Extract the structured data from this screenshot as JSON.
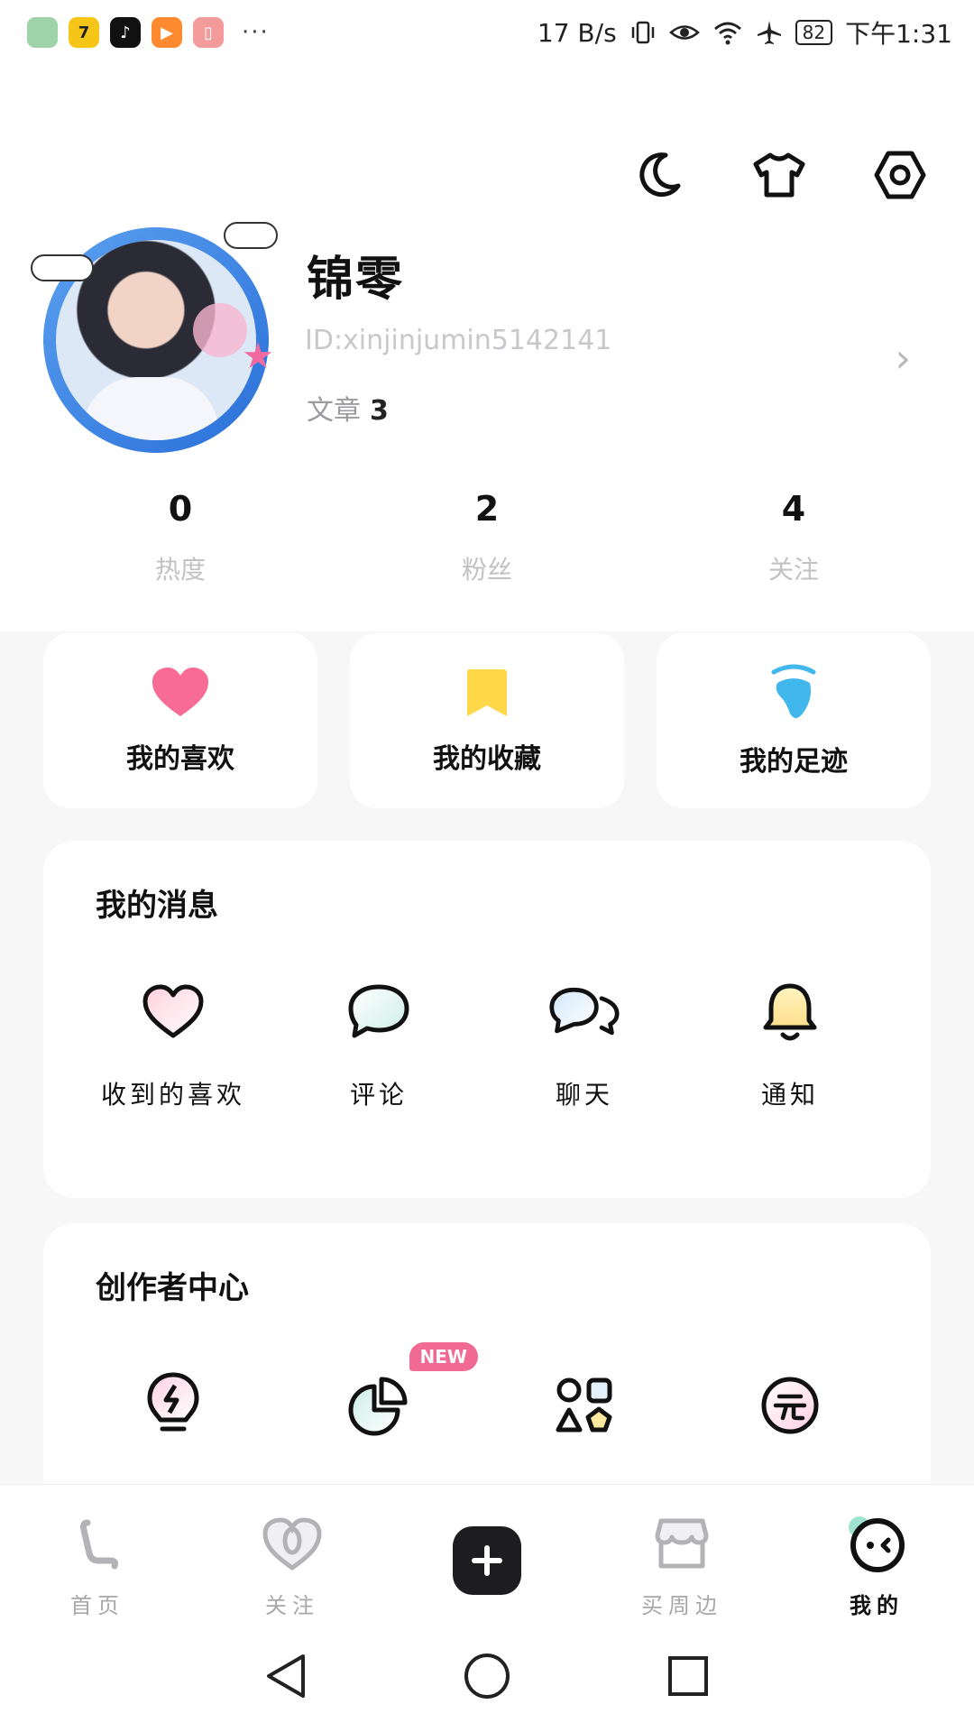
{
  "status_bar": {
    "net_speed": "17 B/s",
    "battery": "82",
    "time": "下午1:31",
    "more": "···",
    "app_icons": [
      {
        "name": "shield-app-icon",
        "color": "#9fd3a9",
        "glyph": ""
      },
      {
        "name": "seven-app-icon",
        "color": "#f5c518",
        "glyph": "7"
      },
      {
        "name": "tiktok-app-icon",
        "color": "#111111",
        "glyph": "♪"
      },
      {
        "name": "video-app-icon",
        "color": "#ff8a30",
        "glyph": "▶"
      },
      {
        "name": "book-app-icon",
        "color": "#f39a9a",
        "glyph": "▯"
      }
    ]
  },
  "profile": {
    "username": "锦零",
    "id": "ID:xinjinjumin5142141",
    "articles_label": "文章",
    "articles_count": "3"
  },
  "stats": [
    {
      "value": "0",
      "label": "热度"
    },
    {
      "value": "2",
      "label": "粉丝"
    },
    {
      "value": "4",
      "label": "关注"
    }
  ],
  "quick_cards": [
    {
      "label": "我的喜欢",
      "icon": "heart-icon"
    },
    {
      "label": "我的收藏",
      "icon": "bookmark-icon"
    },
    {
      "label": "我的足迹",
      "icon": "footprint-icon"
    }
  ],
  "messages": {
    "title": "我的消息",
    "items": [
      {
        "label": "收到的喜欢",
        "icon": "heart-outline-icon"
      },
      {
        "label": "评论",
        "icon": "comment-icon"
      },
      {
        "label": "聊天",
        "icon": "chat-icon"
      },
      {
        "label": "通知",
        "icon": "bell-icon"
      }
    ]
  },
  "creator": {
    "title": "创作者中心",
    "badge": "NEW",
    "items": [
      {
        "icon": "lightbulb-icon"
      },
      {
        "icon": "pie-chart-icon"
      },
      {
        "icon": "shapes-icon"
      },
      {
        "icon": "yuan-icon"
      }
    ]
  },
  "bottom_nav": [
    {
      "label": "首页",
      "icon": "home-icon"
    },
    {
      "label": "关注",
      "icon": "follow-heart-icon"
    },
    {
      "label": "",
      "icon": "plus-icon"
    },
    {
      "label": "买周边",
      "icon": "shop-icon"
    },
    {
      "label": "我的",
      "icon": "me-face-icon"
    }
  ],
  "colors": {
    "heart": "#f96b97",
    "bookmark": "#ffd84a",
    "footprint": "#41b7ee",
    "badge": "#f06a93"
  }
}
